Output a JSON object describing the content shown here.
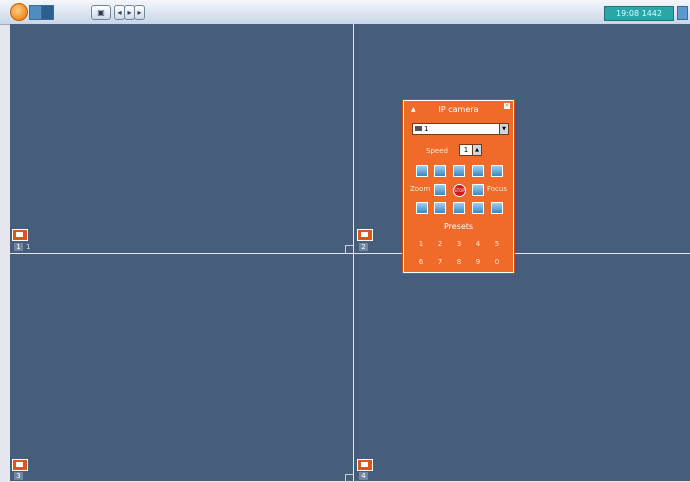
{
  "toolbar": {
    "buttons": [
      "logo",
      "single-view",
      "quad-view",
      "snapshot",
      "prev",
      "play",
      "next"
    ],
    "status_text": "19:08  1442"
  },
  "viewports": [
    {
      "channel": "1",
      "name": "1"
    },
    {
      "channel": "2",
      "name": ""
    },
    {
      "channel": "3",
      "name": ""
    },
    {
      "channel": "4",
      "name": ""
    }
  ],
  "ptz_panel": {
    "title": "IP camera",
    "camera_select": "1",
    "speed_label": "Speed",
    "speed_value": "1",
    "zoom_label": "Zoom",
    "focus_label": "Focus",
    "stop_label": "STOP",
    "presets_label": "Presets",
    "presets_row1": [
      "1",
      "2",
      "3",
      "4",
      "5"
    ],
    "presets_row2": [
      "6",
      "7",
      "8",
      "9",
      "0"
    ]
  }
}
